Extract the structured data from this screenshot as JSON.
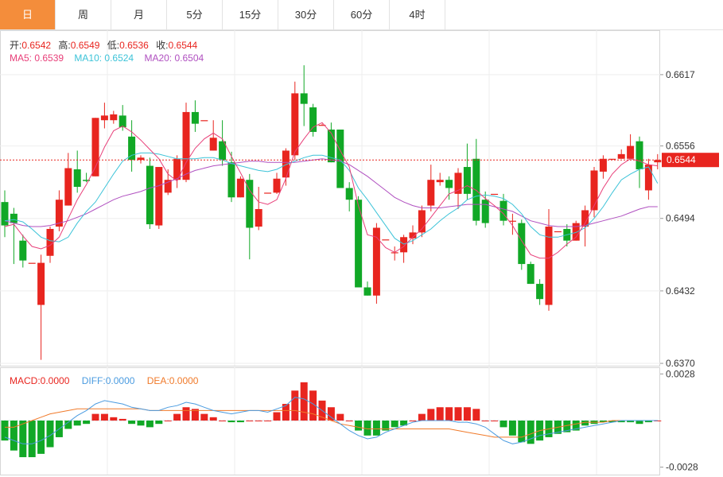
{
  "tabs": [
    {
      "label": "日",
      "active": true
    },
    {
      "label": "周",
      "active": false
    },
    {
      "label": "月",
      "active": false
    },
    {
      "label": "5分",
      "active": false
    },
    {
      "label": "15分",
      "active": false
    },
    {
      "label": "30分",
      "active": false
    },
    {
      "label": "60分",
      "active": false
    },
    {
      "label": "4时",
      "active": false
    }
  ],
  "ohlc_info": {
    "open_label": "开:",
    "open_value": "0.6542",
    "high_label": "高:",
    "high_value": "0.6549",
    "low_label": "低:",
    "low_value": "0.6536",
    "close_label": "收:",
    "close_value": "0.6544"
  },
  "ma_info": {
    "ma5": "MA5: 0.6539",
    "ma10": "MA10: 0.6524",
    "ma20": "MA20: 0.6504"
  },
  "macd_info": {
    "macd": "MACD:0.0000",
    "diff": "DIFF:0.0000",
    "dea": "DEA:0.0000"
  },
  "colors": {
    "up": "#e8251f",
    "down": "#11a826",
    "ma5": "#e8407a",
    "ma10": "#3cc3d8",
    "ma20": "#b050c0",
    "diff": "#4a9be0",
    "dea": "#f07a2a",
    "tab_active": "#f48d3b"
  },
  "chart_data": [
    {
      "type": "candlestick",
      "y_ticks": [
        "0.6617",
        "0.6556",
        "0.6494",
        "0.6432",
        "0.6370"
      ],
      "ylim": [
        0.6368,
        0.6655
      ],
      "last_price_label": "0.6544",
      "candles": [
        [
          0.6508,
          0.6488,
          0.6518,
          0.6478
        ],
        [
          0.6498,
          0.649,
          0.6503,
          0.6455
        ],
        [
          0.6475,
          0.6458,
          0.648,
          0.6452
        ],
        [
          0.6456,
          0.6456,
          0.6456,
          0.6456
        ],
        [
          0.642,
          0.6456,
          0.6463,
          0.6373
        ],
        [
          0.6462,
          0.6485,
          0.6487,
          0.6456
        ],
        [
          0.6487,
          0.651,
          0.6518,
          0.6483
        ],
        [
          0.6505,
          0.6537,
          0.655,
          0.6505
        ],
        [
          0.6536,
          0.6521,
          0.6552,
          0.6516
        ],
        [
          0.6527,
          0.6526,
          0.6533,
          0.6525
        ],
        [
          0.653,
          0.658,
          0.658,
          0.653
        ],
        [
          0.6578,
          0.6582,
          0.6593,
          0.6571
        ],
        [
          0.6578,
          0.6583,
          0.6586,
          0.6575
        ],
        [
          0.6582,
          0.6572,
          0.6591,
          0.6569
        ],
        [
          0.6564,
          0.6544,
          0.6578,
          0.6534
        ],
        [
          0.6544,
          0.6546,
          0.6548,
          0.6541
        ],
        [
          0.6539,
          0.6489,
          0.6546,
          0.6485
        ],
        [
          0.6488,
          0.6538,
          0.6538,
          0.6485
        ],
        [
          0.6516,
          0.6527,
          0.6536,
          0.6514
        ],
        [
          0.6527,
          0.6545,
          0.6548,
          0.652
        ],
        [
          0.6527,
          0.6585,
          0.6593,
          0.6525
        ],
        [
          0.6585,
          0.6575,
          0.6595,
          0.6568
        ],
        [
          0.6578,
          0.6578,
          0.6578,
          0.6578
        ],
        [
          0.6552,
          0.6563,
          0.6578,
          0.6552
        ],
        [
          0.656,
          0.6544,
          0.6578,
          0.6539
        ],
        [
          0.6542,
          0.6512,
          0.6551,
          0.6508
        ],
        [
          0.6512,
          0.6528,
          0.653,
          0.6512
        ],
        [
          0.6527,
          0.6486,
          0.6532,
          0.6459
        ],
        [
          0.6487,
          0.6502,
          0.6521,
          0.6484
        ],
        [
          0.6516,
          0.6516,
          0.6516,
          0.6516
        ],
        [
          0.6516,
          0.6528,
          0.6533,
          0.6515
        ],
        [
          0.6529,
          0.6552,
          0.6554,
          0.6522
        ],
        [
          0.6548,
          0.6601,
          0.6611,
          0.6544
        ],
        [
          0.6601,
          0.6592,
          0.6625,
          0.6573
        ],
        [
          0.6589,
          0.6568,
          0.6592,
          0.6564
        ],
        [
          0.6574,
          0.6574,
          0.6575,
          0.6574
        ],
        [
          0.657,
          0.6542,
          0.6576,
          0.6542
        ],
        [
          0.657,
          0.652,
          0.657,
          0.652
        ],
        [
          0.652,
          0.651,
          0.6525,
          0.65
        ],
        [
          0.651,
          0.6435,
          0.6513,
          0.6435
        ],
        [
          0.6435,
          0.6428,
          0.644,
          0.6428
        ],
        [
          0.6428,
          0.6486,
          0.649,
          0.6421
        ],
        [
          0.6476,
          0.6476,
          0.6476,
          0.6476
        ],
        [
          0.6465,
          0.6465,
          0.647,
          0.6458
        ],
        [
          0.6465,
          0.6478,
          0.648,
          0.6456
        ],
        [
          0.6477,
          0.6482,
          0.6488,
          0.6472
        ],
        [
          0.6482,
          0.6501,
          0.6505,
          0.6478
        ],
        [
          0.6505,
          0.6527,
          0.654,
          0.65
        ],
        [
          0.6525,
          0.6527,
          0.6533,
          0.6522
        ],
        [
          0.6527,
          0.652,
          0.653,
          0.651
        ],
        [
          0.6515,
          0.6533,
          0.6537,
          0.6502
        ],
        [
          0.6538,
          0.6515,
          0.6558,
          0.651
        ],
        [
          0.6545,
          0.6492,
          0.6562,
          0.6488
        ],
        [
          0.651,
          0.649,
          0.6517,
          0.6486
        ],
        [
          0.6515,
          0.6515,
          0.6515,
          0.6515
        ],
        [
          0.6509,
          0.6492,
          0.6515,
          0.6488
        ],
        [
          0.6492,
          0.6492,
          0.6498,
          0.648
        ],
        [
          0.649,
          0.6455,
          0.6493,
          0.645
        ],
        [
          0.6455,
          0.6438,
          0.6457,
          0.6438
        ],
        [
          0.6438,
          0.6425,
          0.6442,
          0.642
        ],
        [
          0.642,
          0.6487,
          0.6502,
          0.6415
        ],
        [
          0.6483,
          0.6483,
          0.6483,
          0.6483
        ],
        [
          0.6485,
          0.6475,
          0.6489,
          0.647
        ],
        [
          0.6475,
          0.649,
          0.6492,
          0.6475
        ],
        [
          0.6487,
          0.6501,
          0.6505,
          0.647
        ],
        [
          0.6501,
          0.6535,
          0.6538,
          0.6495
        ],
        [
          0.6534,
          0.6545,
          0.6548,
          0.6528
        ],
        [
          0.6545,
          0.6545,
          0.6545,
          0.6545
        ],
        [
          0.6545,
          0.6549,
          0.6553,
          0.6545
        ],
        [
          0.6545,
          0.6556,
          0.6566,
          0.6545
        ],
        [
          0.656,
          0.6536,
          0.6564,
          0.652
        ],
        [
          0.6518,
          0.654,
          0.6545,
          0.651
        ],
        [
          0.6542,
          0.6544,
          0.6549,
          0.6536
        ]
      ],
      "ma5": [
        0.6487,
        0.6489,
        0.6479,
        0.647,
        0.6468,
        0.6471,
        0.6478,
        0.6494,
        0.651,
        0.6523,
        0.6538,
        0.6555,
        0.6569,
        0.6573,
        0.6568,
        0.6561,
        0.6553,
        0.6545,
        0.6532,
        0.6526,
        0.6542,
        0.6554,
        0.6562,
        0.6567,
        0.6562,
        0.6547,
        0.6533,
        0.6518,
        0.6508,
        0.6506,
        0.651,
        0.6528,
        0.6551,
        0.6562,
        0.6572,
        0.6576,
        0.6567,
        0.6552,
        0.6538,
        0.6505,
        0.648,
        0.6478,
        0.6469,
        0.6465,
        0.647,
        0.6478,
        0.6485,
        0.6495,
        0.6505,
        0.6515,
        0.6518,
        0.6522,
        0.6518,
        0.6511,
        0.6505,
        0.6498,
        0.6488,
        0.6475,
        0.6463,
        0.646,
        0.646,
        0.6465,
        0.6472,
        0.6478,
        0.649,
        0.6505,
        0.652,
        0.6532,
        0.654,
        0.6545,
        0.6543,
        0.654,
        0.6539
      ],
      "ma10": [
        0.6492,
        0.6493,
        0.6491,
        0.6485,
        0.6478,
        0.6475,
        0.6474,
        0.6478,
        0.649,
        0.65,
        0.6508,
        0.652,
        0.6532,
        0.6543,
        0.6548,
        0.655,
        0.655,
        0.6549,
        0.6547,
        0.6545,
        0.6545,
        0.6545,
        0.6546,
        0.6546,
        0.6544,
        0.6541,
        0.6539,
        0.6537,
        0.6535,
        0.6534,
        0.6536,
        0.654,
        0.6543,
        0.6546,
        0.6548,
        0.6548,
        0.6546,
        0.6544,
        0.6535,
        0.652,
        0.651,
        0.6499,
        0.6488,
        0.6477,
        0.6472,
        0.6475,
        0.648,
        0.6485,
        0.6492,
        0.6498,
        0.6503,
        0.651,
        0.6513,
        0.6514,
        0.6513,
        0.6511,
        0.6506,
        0.6498,
        0.6487,
        0.648,
        0.6478,
        0.6478,
        0.648,
        0.6482,
        0.6486,
        0.6494,
        0.6504,
        0.6516,
        0.6527,
        0.6532,
        0.6536,
        0.6538,
        0.6524
      ],
      "ma20": [
        0.6492,
        0.649,
        0.6488,
        0.6487,
        0.6487,
        0.6488,
        0.649,
        0.6492,
        0.6495,
        0.6498,
        0.6502,
        0.6506,
        0.651,
        0.6513,
        0.6515,
        0.6517,
        0.652,
        0.6522,
        0.6525,
        0.6528,
        0.6532,
        0.6535,
        0.6537,
        0.6539,
        0.654,
        0.6541,
        0.6542,
        0.6543,
        0.6543,
        0.6542,
        0.6542,
        0.6542,
        0.6542,
        0.6543,
        0.6544,
        0.6545,
        0.6544,
        0.6543,
        0.654,
        0.6535,
        0.653,
        0.6524,
        0.6518,
        0.6512,
        0.6508,
        0.6505,
        0.6503,
        0.6503,
        0.6503,
        0.6504,
        0.6505,
        0.6506,
        0.6506,
        0.6506,
        0.6504,
        0.6502,
        0.65,
        0.6496,
        0.6492,
        0.649,
        0.6488,
        0.6487,
        0.6487,
        0.6487,
        0.6488,
        0.649,
        0.6492,
        0.6494,
        0.6496,
        0.6499,
        0.6502,
        0.6504,
        0.6504
      ]
    },
    {
      "type": "macd",
      "y_ticks": [
        "0.0028",
        "-0.0028"
      ],
      "ylim": [
        -0.0032,
        0.0032
      ],
      "hist": [
        -0.0012,
        -0.0018,
        -0.0022,
        -0.0022,
        -0.002,
        -0.0016,
        -0.001,
        -0.0005,
        -0.0003,
        -0.0002,
        0.0004,
        0.0004,
        0.0002,
        0.0001,
        -0.0002,
        -0.0003,
        -0.0004,
        -0.0002,
        0.0,
        0.0004,
        0.0008,
        0.0007,
        0.0004,
        0.0002,
        0.0,
        -0.0001,
        -0.0001,
        0.0,
        0.0,
        0.0,
        0.0005,
        0.001,
        0.0018,
        0.0023,
        0.0018,
        0.0012,
        0.0008,
        0.0004,
        0.0,
        -0.0006,
        -0.0009,
        -0.0009,
        -0.0006,
        -0.0004,
        -0.0003,
        0.0,
        0.0004,
        0.0007,
        0.0008,
        0.0008,
        0.0008,
        0.0008,
        0.0007,
        0.0,
        0.0,
        -0.0004,
        -0.0009,
        -0.0013,
        -0.0014,
        -0.0012,
        -0.001,
        -0.0008,
        -0.0007,
        -0.0006,
        -0.0003,
        -0.0002,
        -0.0001,
        -0.0001,
        -0.0001,
        -0.0001,
        -0.0002,
        -0.0001,
        0.0
      ],
      "diff": [
        -0.001,
        -0.0012,
        -0.0014,
        -0.0014,
        -0.0012,
        -0.0009,
        -0.0005,
        -0.0001,
        0.0003,
        0.0006,
        0.001,
        0.0012,
        0.0011,
        0.001,
        0.0008,
        0.0007,
        0.0006,
        0.0006,
        0.0008,
        0.0009,
        0.0011,
        0.001,
        0.0008,
        0.0006,
        0.0005,
        0.0004,
        0.0005,
        0.0006,
        0.0006,
        0.0005,
        0.0007,
        0.0009,
        0.0014,
        0.0013,
        0.001,
        0.0006,
        0.0002,
        -0.0002,
        -0.0006,
        -0.0009,
        -0.0011,
        -0.001,
        -0.0007,
        -0.0005,
        -0.0003,
        -0.0001,
        0.0,
        0.0,
        0.0,
        0.0,
        -0.0001,
        -0.0001,
        -0.0002,
        -0.0004,
        -0.0008,
        -0.0012,
        -0.0014,
        -0.0013,
        -0.0011,
        -0.0009,
        -0.0008,
        -0.0007,
        -0.0006,
        -0.0005,
        -0.0004,
        -0.0003,
        -0.0002,
        -0.0001,
        0.0,
        0.0,
        0.0,
        0.0,
        0.0
      ],
      "dea": [
        -0.0004,
        -0.0004,
        -0.0002,
        0.0,
        0.0002,
        0.0004,
        0.0005,
        0.0006,
        0.0007,
        0.0007,
        0.0007,
        0.0007,
        0.0007,
        0.0007,
        0.0007,
        0.0007,
        0.0006,
        0.0006,
        0.0006,
        0.0006,
        0.0006,
        0.0006,
        0.0006,
        0.0006,
        0.0006,
        0.0006,
        0.0006,
        0.0006,
        0.0006,
        0.0006,
        0.0006,
        0.0006,
        0.0006,
        0.0005,
        0.0004,
        0.0002,
        0.0,
        -0.0002,
        -0.0003,
        -0.0004,
        -0.0005,
        -0.0005,
        -0.0005,
        -0.0005,
        -0.0005,
        -0.0005,
        -0.0005,
        -0.0005,
        -0.0005,
        -0.0005,
        -0.0006,
        -0.0007,
        -0.0008,
        -0.0009,
        -0.001,
        -0.001,
        -0.001,
        -0.001,
        -0.0008,
        -0.0006,
        -0.0005,
        -0.0004,
        -0.0003,
        -0.0002,
        -0.0001,
        -0.0001,
        -0.0001,
        0.0,
        0.0,
        0.0,
        0.0,
        0.0,
        0.0
      ]
    }
  ]
}
